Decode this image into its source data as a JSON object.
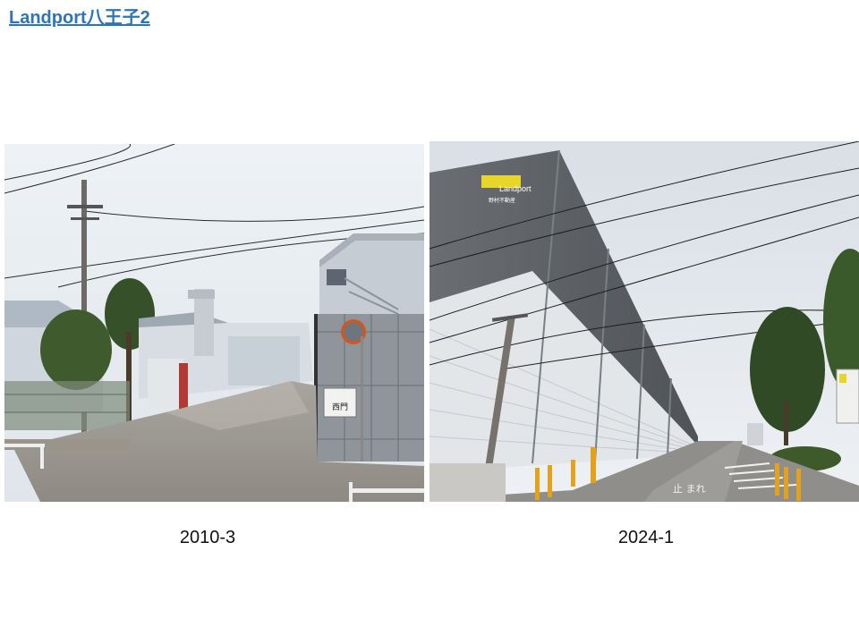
{
  "slide": {
    "title": "Landport八王子2",
    "photos": [
      {
        "caption": "2010-3",
        "signs": {
          "gate": "西門"
        }
      },
      {
        "caption": "2024-1",
        "signs": {
          "brand": "Landport",
          "company": "野村不動産",
          "road_marking": "止 まれ"
        }
      }
    ]
  },
  "colors": {
    "link": "#2e75b6",
    "sky": "#e9eef3",
    "warehouse_panel": "#e8eaec",
    "warehouse_top": "#5f6367",
    "logo_yellow": "#e8d52a"
  }
}
